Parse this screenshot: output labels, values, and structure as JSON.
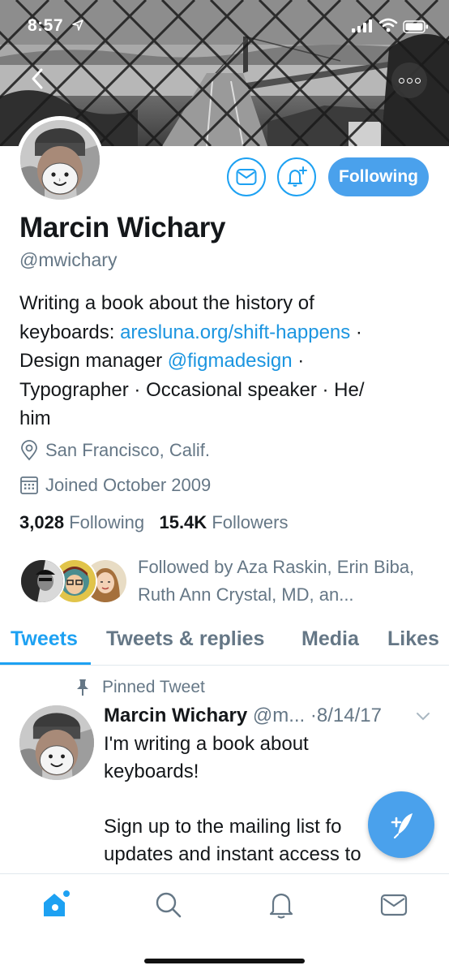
{
  "status_bar": {
    "time": "8:57"
  },
  "profile": {
    "name": "Marcin Wichary",
    "handle": "@mwichary",
    "following_button": "Following",
    "bio": {
      "line1": "Writing a book about the history of",
      "line2_prefix": "keyboards: ",
      "line2_link": "aresluna.org/shift-happens",
      "line2_suffix": " ·",
      "line3_prefix": "Design manager ",
      "line3_link": "@figmadesign",
      "line3_suffix": " ·",
      "line4": "Typographer · Occasional speaker · He/",
      "line5": "him"
    },
    "location": "San Francisco, Calif.",
    "joined": "Joined October 2009",
    "following_count": "3,028",
    "following_label": "Following",
    "followers_count": "15.4K",
    "followers_label": "Followers",
    "followed_by": "Followed by Aza Raskin, Erin Biba, Ruth Ann Crystal, MD, an..."
  },
  "tabs": [
    {
      "label": "Tweets",
      "active": true
    },
    {
      "label": "Tweets & replies",
      "active": false
    },
    {
      "label": "Media",
      "active": false
    },
    {
      "label": "Likes",
      "active": false
    }
  ],
  "tweet": {
    "pinned_label": "Pinned Tweet",
    "author": "Marcin Wichary",
    "handle_truncated": "@m...",
    "date": "·8/14/17",
    "text_line1": "I'm writing a book about",
    "text_line2": "keyboards!",
    "text_line3": "Sign up to the mailing list fo",
    "text_line4": "updates and instant access to"
  },
  "colors": {
    "accent": "#1da1f2",
    "button_fill": "#4aa1ec",
    "secondary_text": "#657786",
    "primary_text": "#14171a"
  },
  "icons": {
    "back": "chevron-left-icon",
    "more": "more-horizontal-icon",
    "message": "envelope-icon",
    "notify": "bell-plus-icon",
    "location": "location-pin-icon",
    "calendar": "calendar-icon",
    "pin": "pin-icon",
    "compose": "compose-feather-icon",
    "nav": [
      "home-icon",
      "search-icon",
      "bell-icon",
      "envelope-icon"
    ]
  }
}
